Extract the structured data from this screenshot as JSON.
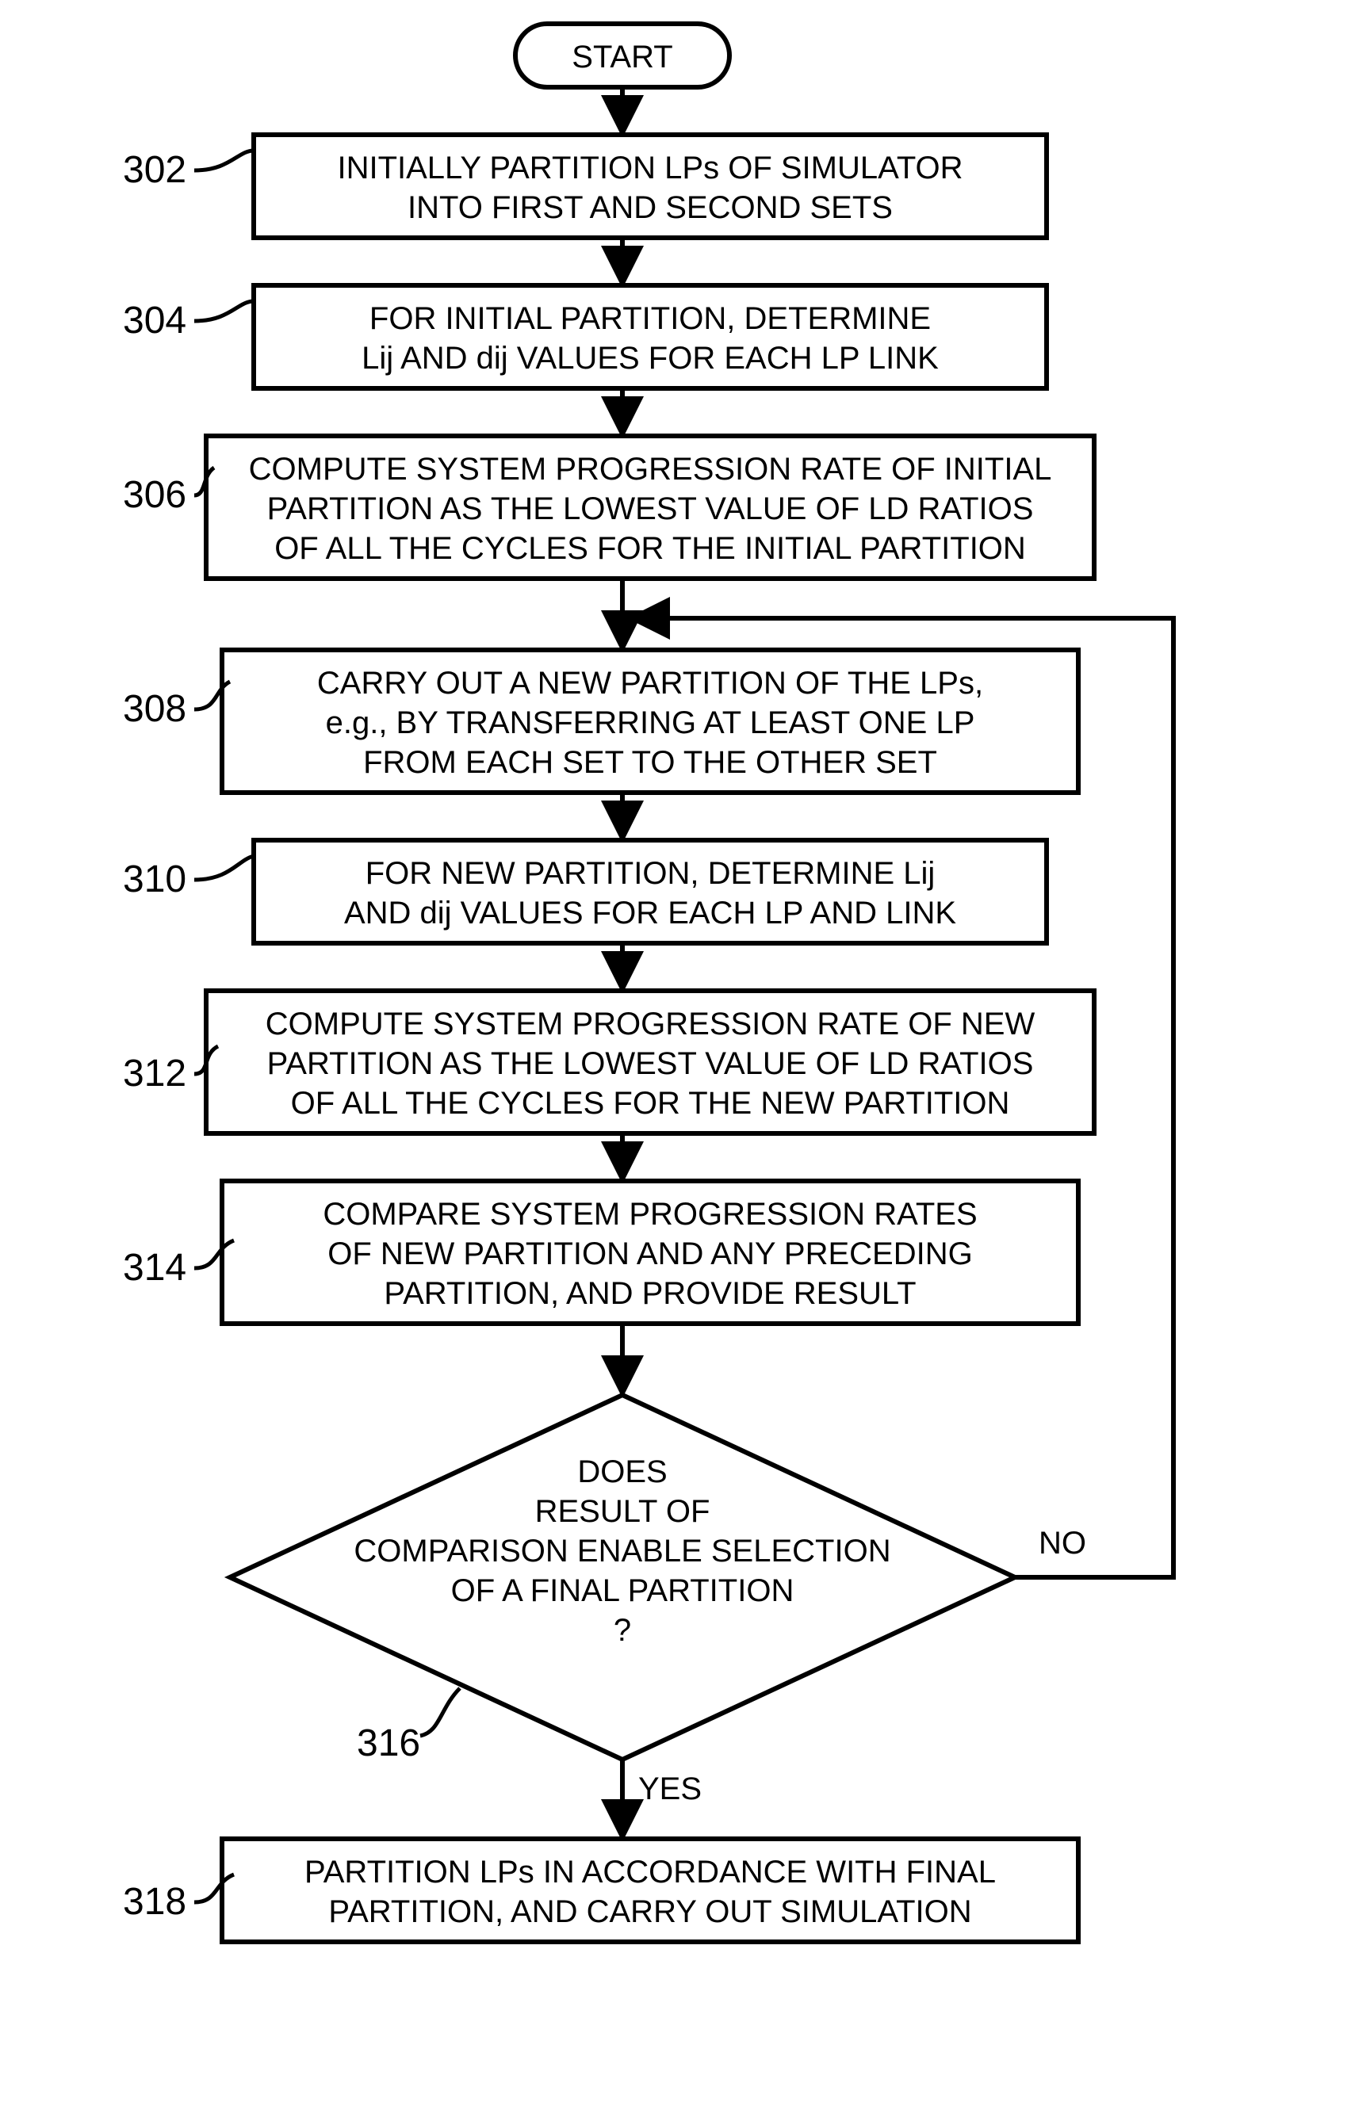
{
  "chart_data": {
    "type": "flowchart",
    "start": "START",
    "steps": [
      {
        "id": "302",
        "text": [
          "INITIALLY PARTITION LPs OF SIMULATOR",
          "INTO FIRST AND SECOND SETS"
        ]
      },
      {
        "id": "304",
        "text": [
          "FOR INITIAL PARTITION, DETERMINE",
          "Lij AND dij VALUES FOR EACH LP LINK"
        ]
      },
      {
        "id": "306",
        "text": [
          "COMPUTE SYSTEM PROGRESSION RATE OF INITIAL",
          "PARTITION AS THE LOWEST VALUE OF LD RATIOS",
          "OF ALL THE CYCLES FOR THE INITIAL PARTITION"
        ]
      },
      {
        "id": "308",
        "text": [
          "CARRY OUT A NEW PARTITION OF THE LPs,",
          "e.g., BY TRANSFERRING AT LEAST ONE LP",
          "FROM EACH SET TO THE OTHER SET"
        ]
      },
      {
        "id": "310",
        "text": [
          "FOR NEW PARTITION, DETERMINE Lij",
          "AND dij VALUES FOR EACH LP AND LINK"
        ]
      },
      {
        "id": "312",
        "text": [
          "COMPUTE SYSTEM PROGRESSION RATE OF NEW",
          "PARTITION AS THE LOWEST VALUE OF LD RATIOS",
          "OF ALL THE CYCLES FOR THE NEW PARTITION"
        ]
      },
      {
        "id": "314",
        "text": [
          "COMPARE SYSTEM PROGRESSION RATES",
          "OF NEW PARTITION AND ANY PRECEDING",
          "PARTITION, AND PROVIDE RESULT"
        ]
      },
      {
        "id": "316",
        "type": "decision",
        "text": [
          "DOES",
          "RESULT OF",
          "COMPARISON ENABLE SELECTION",
          "OF A FINAL PARTITION",
          "?"
        ],
        "yes": "318",
        "no": "308"
      },
      {
        "id": "318",
        "text": [
          "PARTITION LPs IN ACCORDANCE WITH FINAL",
          "PARTITION, AND CARRY OUT SIMULATION"
        ]
      }
    ],
    "branches": {
      "yes": "YES",
      "no": "NO"
    }
  }
}
